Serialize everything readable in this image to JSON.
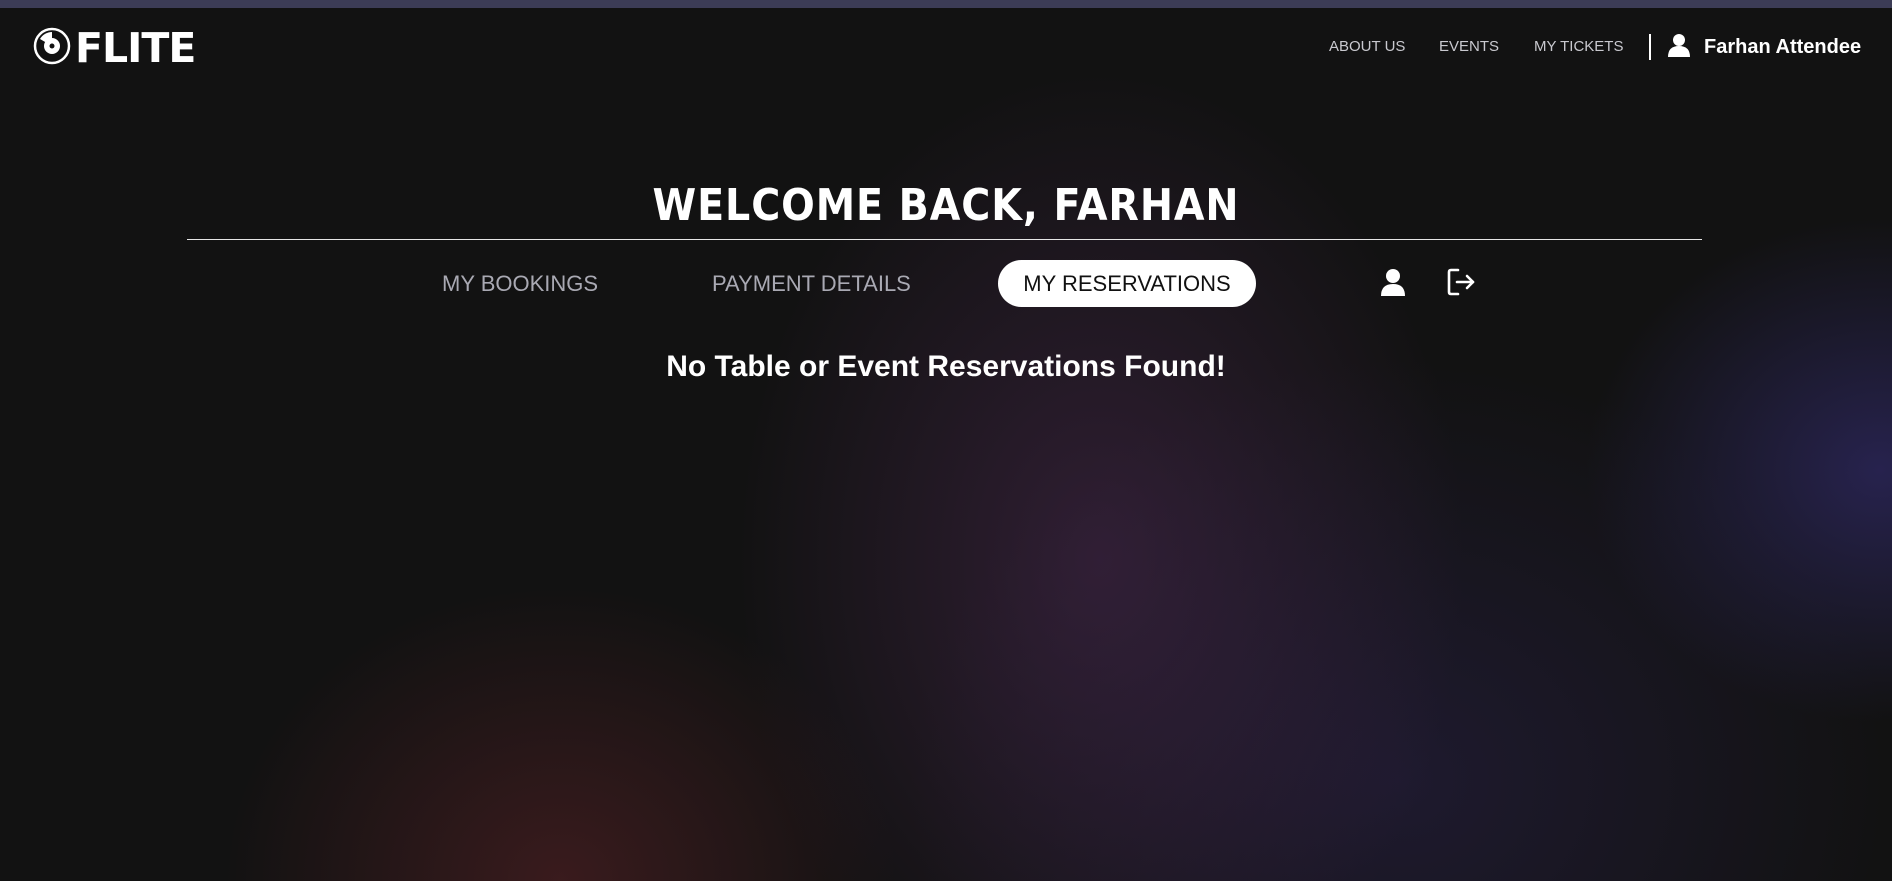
{
  "header": {
    "logo_text": "FLITE",
    "nav": {
      "about": "ABOUT US",
      "events": "EVENTS",
      "tickets": "MY TICKETS"
    },
    "user_name": "Farhan Attendee"
  },
  "main": {
    "welcome": "WELCOME BACK, FARHAN",
    "tabs": {
      "bookings": "MY BOOKINGS",
      "payment": "PAYMENT DETAILS",
      "reservations": "MY RESERVATIONS"
    },
    "active_tab": "MY RESERVATIONS",
    "empty_message": "No Table or Event Reservations Found!"
  },
  "icons": {
    "logo": "vinyl-record-icon",
    "user": "user-icon",
    "profile": "profile-icon",
    "logout": "logout-icon"
  },
  "colors": {
    "background": "#121212",
    "active_tab_bg": "#ffffff",
    "inactive_tab_text": "#a9a9b3"
  }
}
